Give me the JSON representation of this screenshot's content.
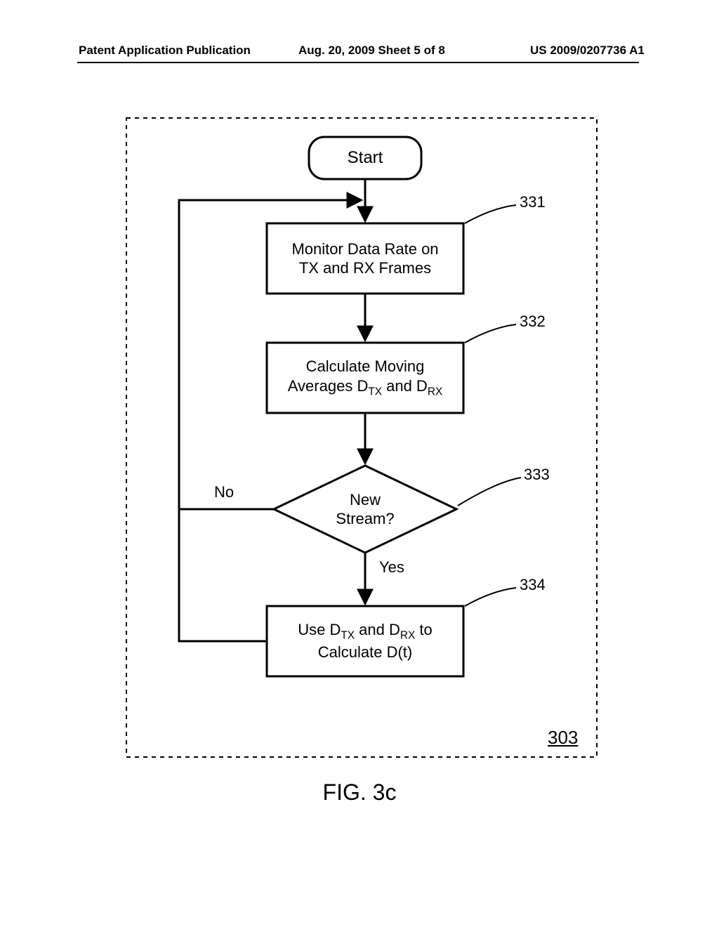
{
  "header": {
    "left": "Patent Application Publication",
    "middle": "Aug. 20, 2009  Sheet 5 of 8",
    "right": "US 2009/0207736 A1"
  },
  "flowchart": {
    "start": "Start",
    "step331": {
      "ref": "331",
      "text": "Monitor Data Rate on\nTX and  RX Frames"
    },
    "step332": {
      "ref": "332",
      "text_prefix": "Calculate  Moving\nAverages D",
      "sub1": "TX",
      "mid": " and D",
      "sub2": "RX"
    },
    "decision333": {
      "ref": "333",
      "text": "New\nStream?",
      "yes": "Yes",
      "no": "No"
    },
    "step334": {
      "ref": "334",
      "text_prefix": "Use D",
      "sub1": "TX",
      "mid": " and D",
      "sub2": "RX",
      "suffix": " to\nCalculate D(t)"
    },
    "container_ref": "303"
  },
  "caption": "FIG. 3c"
}
